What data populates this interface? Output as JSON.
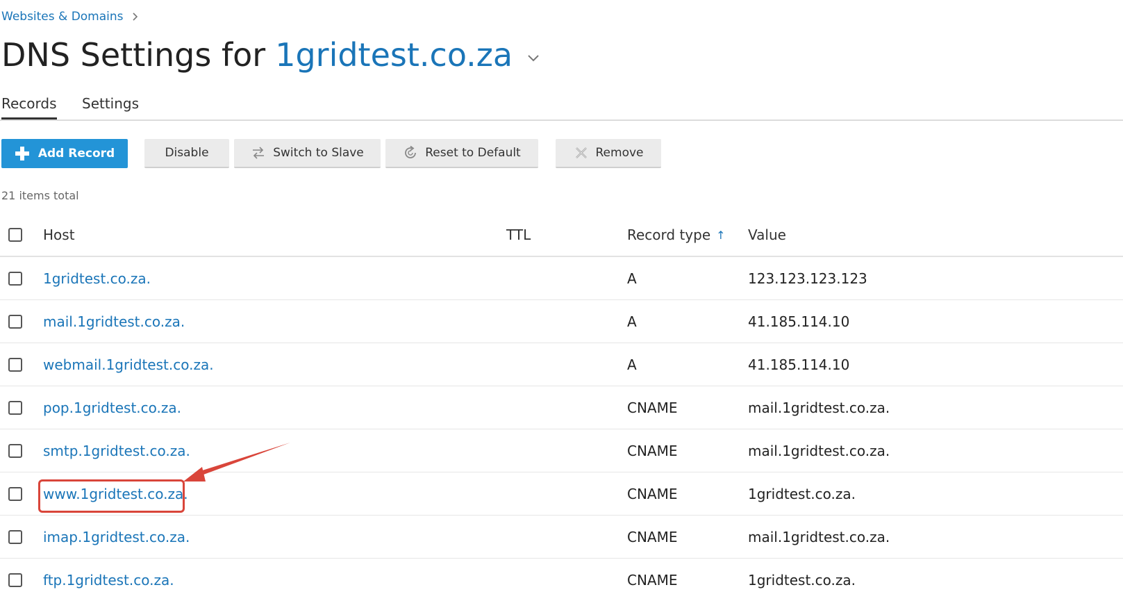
{
  "breadcrumb": {
    "link": "Websites & Domains"
  },
  "header": {
    "title_prefix": "DNS Settings for",
    "domain": "1gridtest.co.za"
  },
  "tabs": [
    {
      "label": "Records",
      "active": true
    },
    {
      "label": "Settings",
      "active": false
    }
  ],
  "toolbar": {
    "add_record": "Add Record",
    "disable": "Disable",
    "switch_to_slave": "Switch to Slave",
    "reset_to_default": "Reset to Default",
    "remove": "Remove"
  },
  "items_total": "21 items total",
  "table": {
    "columns": {
      "host": "Host",
      "ttl": "TTL",
      "record_type": "Record type",
      "value": "Value"
    },
    "sort_indicator": "↑",
    "rows": [
      {
        "host": "1gridtest.co.za.",
        "ttl": "",
        "type": "A",
        "value": "123.123.123.123"
      },
      {
        "host": "mail.1gridtest.co.za.",
        "ttl": "",
        "type": "A",
        "value": "41.185.114.10"
      },
      {
        "host": "webmail.1gridtest.co.za.",
        "ttl": "",
        "type": "A",
        "value": "41.185.114.10"
      },
      {
        "host": "pop.1gridtest.co.za.",
        "ttl": "",
        "type": "CNAME",
        "value": "mail.1gridtest.co.za."
      },
      {
        "host": "smtp.1gridtest.co.za.",
        "ttl": "",
        "type": "CNAME",
        "value": "mail.1gridtest.co.za."
      },
      {
        "host": "www.1gridtest.co.za.",
        "ttl": "",
        "type": "CNAME",
        "value": "1gridtest.co.za."
      },
      {
        "host": "imap.1gridtest.co.za.",
        "ttl": "",
        "type": "CNAME",
        "value": "mail.1gridtest.co.za."
      },
      {
        "host": "ftp.1gridtest.co.za.",
        "ttl": "",
        "type": "CNAME",
        "value": "1gridtest.co.za."
      }
    ]
  },
  "colors": {
    "link": "#1a75b8",
    "primary_button": "#2394d7",
    "annotation": "#d9453a"
  },
  "icons": {
    "breadcrumb_separator": "chevron-right-icon",
    "title_dropdown": "chevron-down-icon",
    "add": "plus-icon",
    "switch_to_slave": "switch-arrows-icon",
    "reset_to_default": "reset-icon",
    "remove": "remove-x-icon"
  }
}
